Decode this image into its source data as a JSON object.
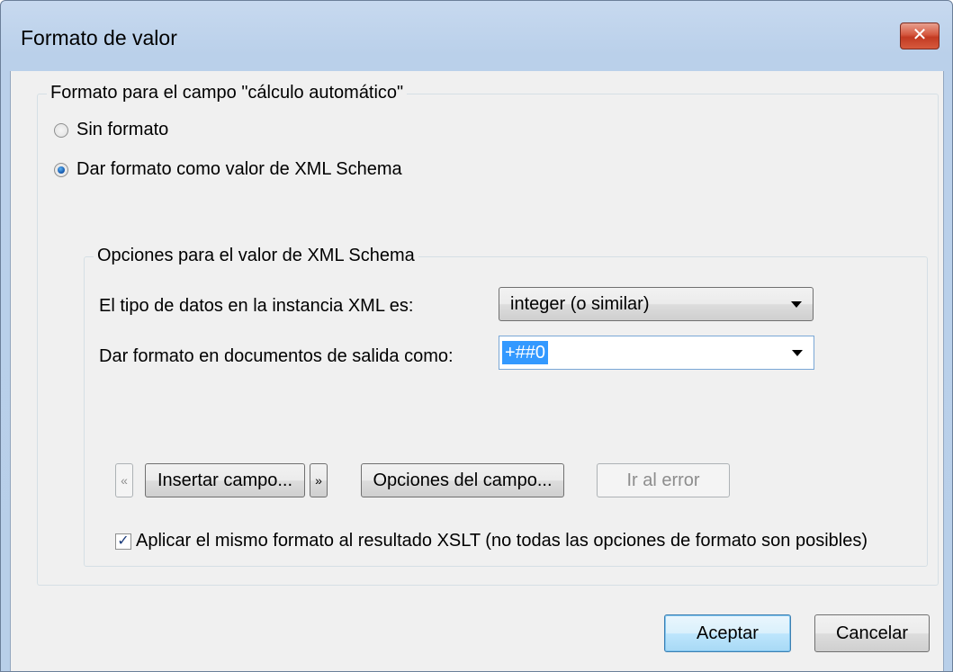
{
  "window": {
    "title": "Formato de valor",
    "close_glyph": "✕"
  },
  "group_main": {
    "legend": "Formato para el campo \"cálculo automático\"",
    "radio_none": {
      "label": "Sin formato",
      "checked": false
    },
    "radio_schema": {
      "label": "Dar formato como valor de XML Schema",
      "checked": true
    }
  },
  "group_schema": {
    "legend": "Opciones para el valor de XML Schema",
    "datatype_label": "El tipo de datos en la instancia XML es:",
    "datatype_value": "integer (o similar)",
    "format_label": "Dar formato en documentos de salida como:",
    "format_value": "+##0",
    "prev_button": "«",
    "insert_field_button": "Insertar campo...",
    "next_button": "»",
    "field_options_button": "Opciones del campo...",
    "goto_error_button": "Ir al error",
    "apply_xslt_label": "Aplicar el mismo formato al resultado XSLT (no todas las opciones de formato son posibles)",
    "apply_xslt_checked": true
  },
  "footer": {
    "ok_button": "Aceptar",
    "cancel_button": "Cancelar"
  },
  "icons": {
    "close": "close-icon",
    "dropdown": "chevron-down-icon",
    "check": "checkmark-icon"
  }
}
